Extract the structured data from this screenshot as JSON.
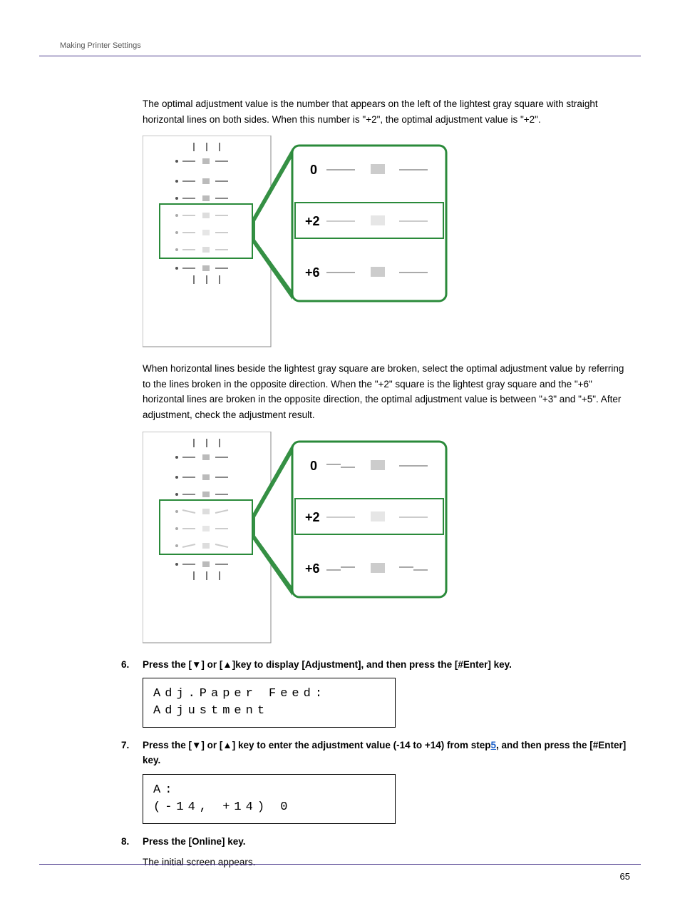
{
  "running_head": "Making Printer Settings",
  "para1": "The optimal adjustment value is the number that appears on the left of the lightest gray square with straight horizontal lines on both sides. When this number is \"+2\", the optimal adjustment value is \"+2\".",
  "para2": "When horizontal lines beside the lightest gray square are broken, select the optimal adjustment value by referring to the lines broken in the opposite direction. When the \"+2\" square is the lightest gray square and the \"+6\" horizontal lines are broken in the opposite direction, the optimal adjustment value is between \"+3\" and \"+5\". After adjustment, check the adjustment result.",
  "diagram1": {
    "callout_labels": [
      "0",
      "+2",
      "+6"
    ]
  },
  "diagram2": {
    "callout_labels": [
      "0",
      "+2",
      "+6"
    ]
  },
  "step6": {
    "num": "6.",
    "text_a": "Press the [",
    "text_b": "] or [",
    "text_c": "]key to display [Adjustment], and then press the [#Enter] key."
  },
  "lcd1_line1": "Adj.Paper Feed:",
  "lcd1_line2": "Adjustment",
  "step7": {
    "num": "7.",
    "text_a": "Press the [",
    "text_b": "] or [",
    "text_c": "] key to enter the adjustment value (-14 to +14) from step",
    "link": "5",
    "text_d": ", and then press the [#Enter] key."
  },
  "lcd2_line1": "A:",
  "lcd2_line2": "(-14, +14)   0",
  "step8": {
    "num": "8.",
    "text": "Press the [Online] key."
  },
  "step8_sub": "The initial screen appears.",
  "page_number": "65"
}
